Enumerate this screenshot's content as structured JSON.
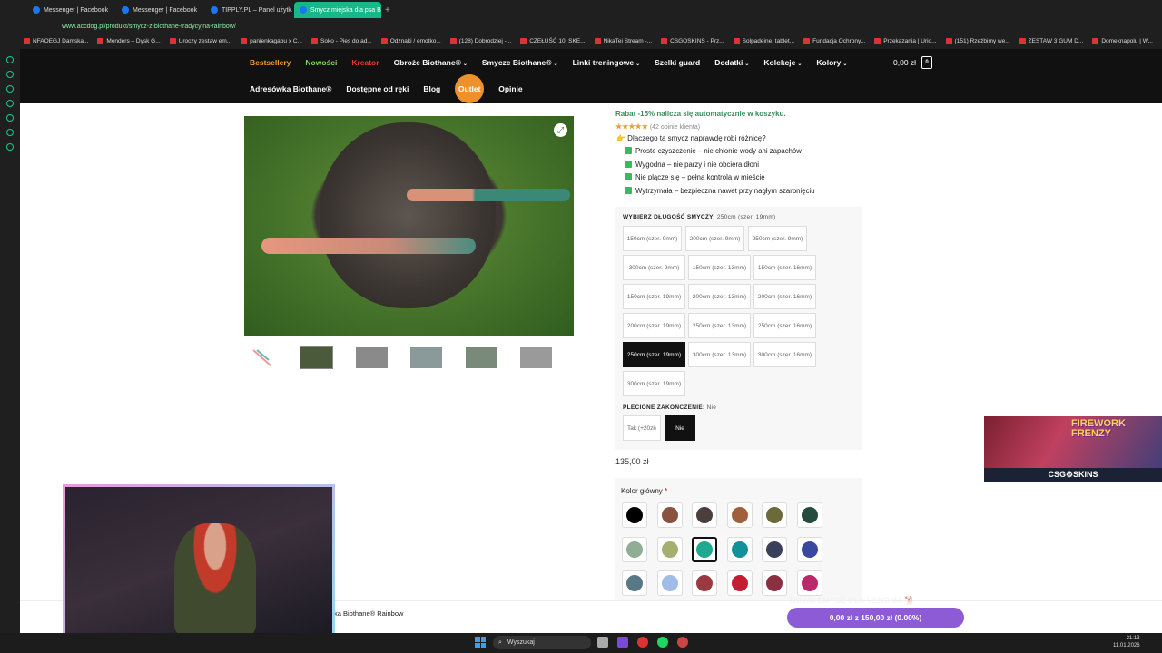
{
  "browser": {
    "tabs": [
      {
        "label": "Messenger | Facebook",
        "active": false
      },
      {
        "label": "Messenger | Facebook",
        "active": false
      },
      {
        "label": "TIPPLY.PL – Panel użytk...",
        "active": false
      },
      {
        "label": "Smycz miejska dla psa Bi...",
        "active": true
      }
    ],
    "url": "www.accdog.pl/produkt/smycz-z-biothane-tradycyjna-rainbow/",
    "bookmarks": [
      "NFAOEGJ Damska...",
      "Menders – Dysk G...",
      "Uroczy zestaw em...",
      "panienkagabu x C...",
      "Soko - Pies do ad...",
      "Odznaki / emotko...",
      "(128) Dobrodziej -...",
      "CZEŁUŚĆ 10: SKE...",
      "NikaTei Stream -...",
      "CSGOSKINS - Prz...",
      "Solpadeine, tablet...",
      "Fundacja Ochrony...",
      "Przekazania | Urio...",
      "(151) Rzeźbimy we...",
      "ZESTAW 3 GUM D...",
      "Domeknapolu | W..."
    ]
  },
  "nav": {
    "row1": [
      {
        "label": "Bestsellery",
        "color": "orange",
        "caret": false
      },
      {
        "label": "Nowości",
        "color": "green",
        "caret": false
      },
      {
        "label": "Kreator",
        "color": "red",
        "caret": false
      },
      {
        "label": "Obroże Biothane®",
        "color": "white",
        "caret": true
      },
      {
        "label": "Smycze Biothane®",
        "color": "white",
        "caret": true
      },
      {
        "label": "Linki treningowe",
        "color": "white",
        "caret": true
      },
      {
        "label": "Szelki guard",
        "color": "white",
        "caret": false
      },
      {
        "label": "Dodatki",
        "color": "white",
        "caret": true
      },
      {
        "label": "Kolekcje",
        "color": "white",
        "caret": true
      },
      {
        "label": "Kolory",
        "color": "white",
        "caret": true
      }
    ],
    "row2": [
      {
        "label": "Adresówka Biothane®",
        "pill": false
      },
      {
        "label": "Dostępne od ręki",
        "pill": false
      },
      {
        "label": "Blog",
        "pill": false
      },
      {
        "label": "Outlet",
        "pill": true
      },
      {
        "label": "Opinie",
        "pill": false
      }
    ],
    "cart_total": "0,00 zł",
    "cart_count": "0"
  },
  "product": {
    "promo": "Rabat -15% nalicza się automatycznie w koszyku.",
    "stars": "★★★★★",
    "reviews": "(42 opinie klienta)",
    "why": "👉 Dlaczego ta smycz naprawdę robi różnicę?",
    "benefits": [
      "Proste czyszczenie – nie chłonie wody ani zapachów",
      "Wygodna – nie parzy i nie obciera dłoni",
      "Nie plącze się – pełna kontrola w mieście",
      "Wytrzymała – bezpieczna nawet przy nagłym szarpnięciu"
    ],
    "length_label": "WYBIERZ DŁUGOŚĆ SMYCZY:",
    "length_value": "250cm (szer. 19mm)",
    "lengths": [
      "150cm (szer. 9mm)",
      "200cm (szer. 9mm)",
      "250cm (szer. 9mm)",
      "300cm (szer. 9mm)",
      "150cm (szer. 13mm)",
      "150cm (szer. 16mm)",
      "150cm (szer. 19mm)",
      "200cm (szer. 13mm)",
      "200cm (szer. 16mm)",
      "200cm (szer. 19mm)",
      "250cm (szer. 13mm)",
      "250cm (szer. 16mm)",
      "250cm (szer. 19mm)",
      "300cm (szer. 13mm)",
      "300cm (szer. 16mm)",
      "300cm (szer. 19mm)"
    ],
    "selected_length": "250cm (szer. 19mm)",
    "braid_label": "PLECIONE ZAKOŃCZENIE:",
    "braid_value": "Nie",
    "braid_options": [
      "Tak (+20zł)",
      "Nie"
    ],
    "price": "135,00 zł",
    "color_label": "Kolor główny",
    "required_mark": "*",
    "colors": [
      "#000000",
      "#8a5040",
      "#4a3f3c",
      "#a0603c",
      "#6a6a3a",
      "#254a3f",
      "#8fae94",
      "#a5b070",
      "#1fa98f",
      "#11919a",
      "#3a3f5a",
      "#3a48a0",
      "#587888",
      "#9fbde8",
      "#9a3a40",
      "#c41c30",
      "#8a3040",
      "#b82a6a"
    ],
    "selected_color_index": 8
  },
  "sticky": {
    "product_name": "ka Biothane® Rainbow",
    "button": "0,00 zł z 150,00 zł (0.00%)"
  },
  "overlay": {
    "ticker": "NOWA SMYCZ DLA VENOMA 🐕",
    "ad_title": "FIREWORK FRENZY",
    "ad_brand": "CSG⚙SKINS"
  },
  "taskbar": {
    "search": "Wyszukaj",
    "time": "21:13",
    "date": "11.01.2026"
  }
}
